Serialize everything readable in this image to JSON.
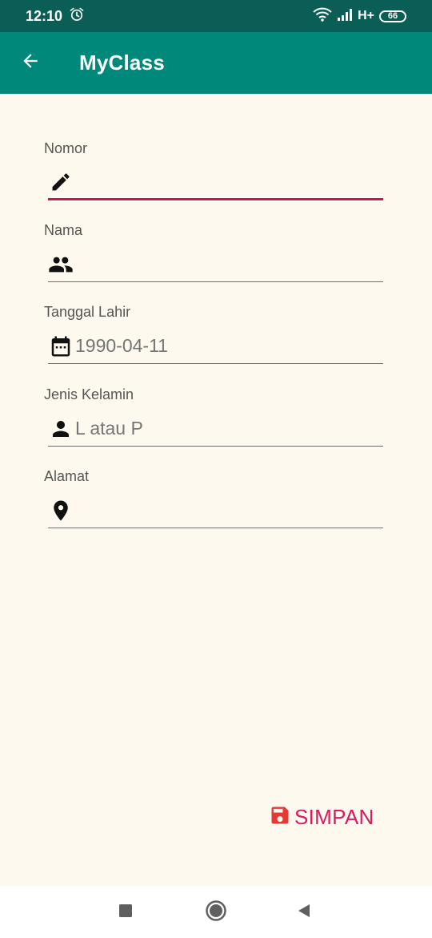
{
  "status_bar": {
    "time": "12:10",
    "network": "H+",
    "battery": "66"
  },
  "app_bar": {
    "title": "MyClass"
  },
  "form": {
    "fields": [
      {
        "label": "Nomor",
        "value": "",
        "placeholder": "",
        "icon": "pencil-icon"
      },
      {
        "label": "Nama",
        "value": "",
        "placeholder": "",
        "icon": "people-icon"
      },
      {
        "label": "Tanggal Lahir",
        "value": "",
        "placeholder": "1990-04-11",
        "icon": "calendar-icon"
      },
      {
        "label": "Jenis Kelamin",
        "value": "",
        "placeholder": "L atau P",
        "icon": "person-icon"
      },
      {
        "label": "Alamat",
        "value": "",
        "placeholder": "",
        "icon": "location-pin-icon"
      }
    ]
  },
  "actions": {
    "save_label": "SIMPAN",
    "save_icon": "floppy-disk-icon"
  },
  "colors": {
    "status_bar": "#0b5e56",
    "app_bar": "#00897b",
    "background": "#fdf9ee",
    "accent": "#c2185b",
    "save_text": "#d81b60",
    "save_icon": "#e53935"
  }
}
